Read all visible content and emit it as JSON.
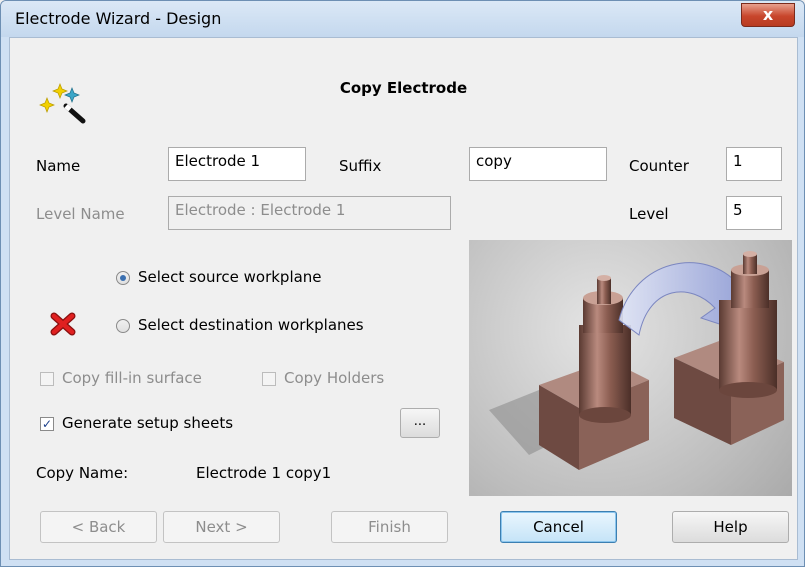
{
  "window": {
    "title": "Electrode Wizard - Design",
    "close_label": "x"
  },
  "header": {
    "title": "Copy Electrode",
    "icon": "magic-wand-icon"
  },
  "fields": {
    "name_label": "Name",
    "name_value": "Electrode 1",
    "suffix_label": "Suffix",
    "suffix_value": "copy",
    "counter_label": "Counter",
    "counter_value": "1",
    "level_name_label": "Level Name",
    "level_name_value": "Electrode : Electrode 1",
    "level_label": "Level",
    "level_value": "5"
  },
  "options": {
    "source_workplane": {
      "label": "Select source workplane",
      "selected": true
    },
    "destination_workplanes": {
      "label": "Select destination workplanes",
      "selected": false,
      "status_icon": "error-x-icon"
    },
    "copy_fill_in_surface": {
      "label": "Copy fill-in surface",
      "checked": false,
      "enabled": false
    },
    "copy_holders": {
      "label": "Copy Holders",
      "checked": false,
      "enabled": false
    },
    "generate_setup_sheets": {
      "label": "Generate setup sheets",
      "checked": true,
      "enabled": true
    },
    "browse_label": "..."
  },
  "copy_name": {
    "label": "Copy Name:",
    "value": "Electrode 1 copy1"
  },
  "buttons": {
    "back": "< Back",
    "next": "Next >",
    "finish": "Finish",
    "cancel": "Cancel",
    "help": "Help"
  },
  "colors": {
    "accent": "#3c7fb1",
    "error": "#d01818",
    "electrode": "#8a5a4f"
  }
}
